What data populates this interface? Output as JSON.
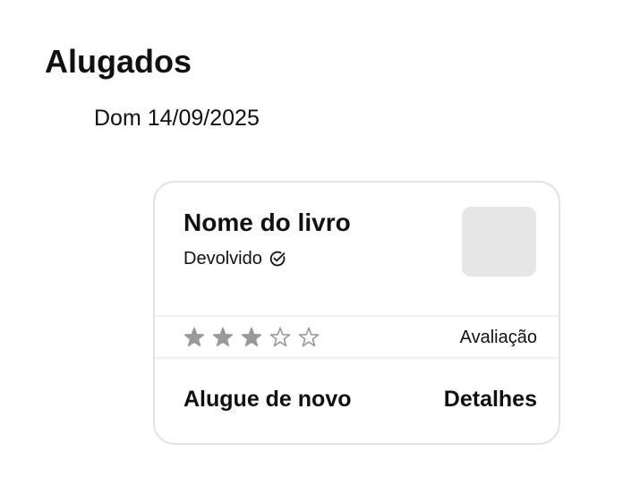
{
  "page": {
    "title": "Alugados",
    "date": "Dom 14/09/2025"
  },
  "card": {
    "book_title": "Nome do livro",
    "status": "Devolvido",
    "status_icon": "check-circle-icon",
    "rating": {
      "value": 3,
      "max": 5,
      "filled_color": "#999999",
      "empty_color": "#999999",
      "label": "Avaliação"
    },
    "actions": {
      "rent_again": "Alugue de novo",
      "details": "Detalhes"
    },
    "thumbnail_color": "#e6e6e6"
  }
}
